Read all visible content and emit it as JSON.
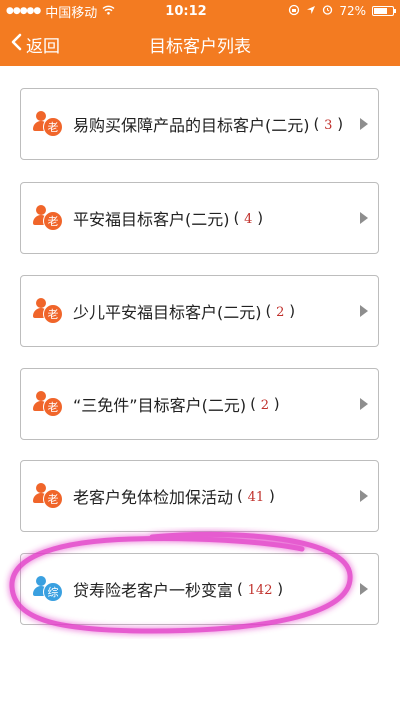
{
  "status_bar": {
    "signal": "●●●●●",
    "carrier": "中国移动",
    "wifi_icon": "wifi-icon",
    "time": "10:12",
    "battery_percent": "72%",
    "battery_level": 0.72
  },
  "nav": {
    "back_label": "返回",
    "title": "目标客户列表"
  },
  "colors": {
    "header_bg": "#f37b21",
    "old_badge": "#f0652a",
    "comprehensive_badge": "#3aa0e0",
    "count_text": "#c0312c",
    "highlight": "#e23fc8"
  },
  "list": [
    {
      "badge": "老",
      "badge_type": "old",
      "label": "易购买保障产品的目标客户(二元)",
      "count_open": "(",
      "count": "3",
      "count_close": ")"
    },
    {
      "badge": "老",
      "badge_type": "old",
      "label": "平安福目标客户(二元)",
      "count_open": "(",
      "count": "4",
      "count_close": ")"
    },
    {
      "badge": "老",
      "badge_type": "old",
      "label": "少儿平安福目标客户(二元)",
      "count_open": "(",
      "count": "2",
      "count_close": ")"
    },
    {
      "badge": "老",
      "badge_type": "old",
      "label": "“三免件”目标客户(二元)",
      "count_open": "(",
      "count": "2",
      "count_close": ")"
    },
    {
      "badge": "老",
      "badge_type": "old",
      "label": "老客户免体检加保活动",
      "count_open": "(",
      "count": "41",
      "count_close": ")"
    },
    {
      "badge": "综",
      "badge_type": "comprehensive",
      "label": "贷寿险老客户一秒变富",
      "count_open": "(",
      "count": "142",
      "count_close": ")"
    }
  ]
}
